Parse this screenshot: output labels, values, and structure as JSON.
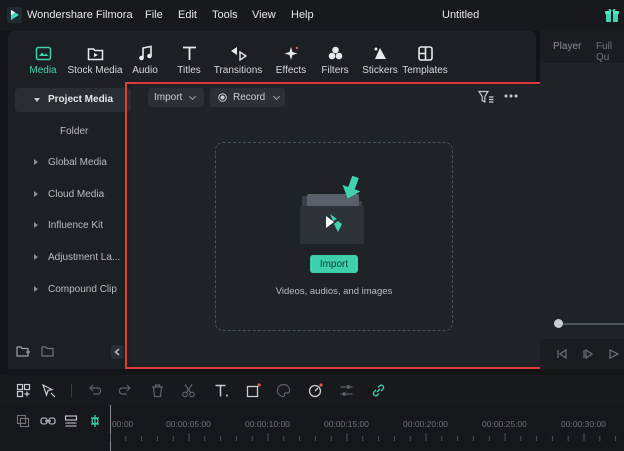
{
  "app": {
    "name": "Wondershare Filmora",
    "document_title": "Untitled",
    "menu": [
      "File",
      "Edit",
      "Tools",
      "View",
      "Help"
    ]
  },
  "toolbar": {
    "tools": [
      {
        "label": "Media",
        "icon": "media-icon",
        "active": true
      },
      {
        "label": "Stock Media",
        "icon": "stock-media-icon"
      },
      {
        "label": "Audio",
        "icon": "music-note-icon"
      },
      {
        "label": "Titles",
        "icon": "text-t-icon"
      },
      {
        "label": "Transitions",
        "icon": "transitions-icon"
      },
      {
        "label": "Effects",
        "icon": "sparkle-icon"
      },
      {
        "label": "Filters",
        "icon": "filters-icon"
      },
      {
        "label": "Stickers",
        "icon": "stickers-icon"
      },
      {
        "label": "Templates",
        "icon": "templates-icon"
      }
    ]
  },
  "sidebar": {
    "items": [
      {
        "label": "Project Media",
        "selected": true
      },
      {
        "label": "Folder",
        "sub": true
      },
      {
        "label": "Global Media"
      },
      {
        "label": "Cloud Media"
      },
      {
        "label": "Influence Kit"
      },
      {
        "label": "Adjustment La..."
      },
      {
        "label": "Compound Clip"
      }
    ]
  },
  "content": {
    "import_dropdown": "Import",
    "record_dropdown": "Record",
    "import_button": "Import",
    "hint": "Videos, audios, and images"
  },
  "player": {
    "tabs": [
      "Player",
      "Full Qu"
    ]
  },
  "timeline": {
    "ticks": [
      "00:00",
      "00:00:05:00",
      "00:00:10:00",
      "00:00:15:00",
      "00:00:20:00",
      "00:00:25:00",
      "00:00:30:00"
    ]
  },
  "colors": {
    "accent": "#3fd3b0",
    "highlight_border": "#e03a3a",
    "record_dot": "#e05a4a"
  }
}
